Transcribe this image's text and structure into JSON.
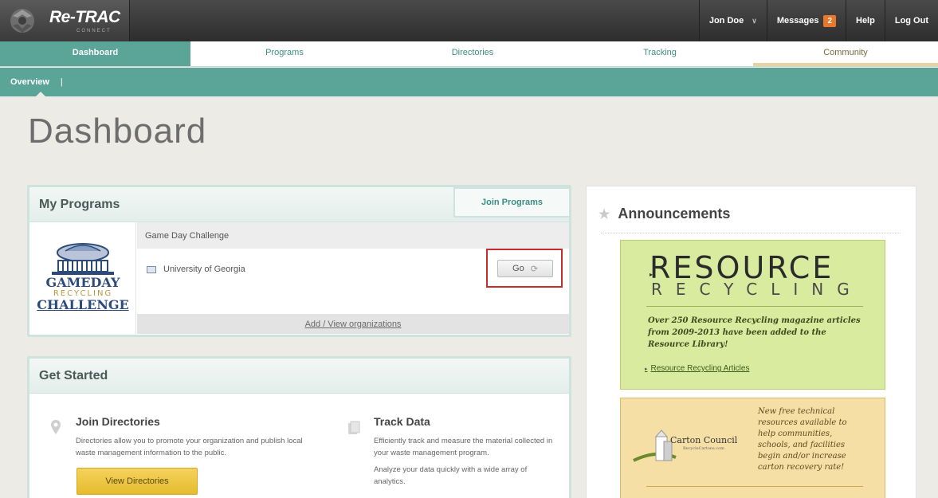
{
  "header": {
    "logo_text": "Re-TRAC",
    "logo_sub": "CONNECT",
    "user_name": "Jon Doe",
    "messages_label": "Messages",
    "messages_count": "2",
    "help_label": "Help",
    "logout_label": "Log Out"
  },
  "nav": {
    "tabs": [
      {
        "label": "Dashboard"
      },
      {
        "label": "Programs"
      },
      {
        "label": "Directories"
      },
      {
        "label": "Tracking"
      },
      {
        "label": "Community"
      }
    ]
  },
  "subnav": {
    "overview_label": "Overview",
    "separator": "|"
  },
  "page": {
    "title": "Dashboard"
  },
  "my_programs": {
    "title": "My Programs",
    "join_button": "Join Programs",
    "program_name": "Game Day Challenge",
    "logo_line1": "GAMEDAY",
    "logo_line2": "RECYCLING",
    "logo_line3": "CHALLENGE",
    "organization": "University of Georgia",
    "go_button": "Go",
    "add_link": "Add / View organizations"
  },
  "get_started": {
    "title": "Get Started",
    "join_directories": {
      "title": "Join Directories",
      "text": "Directories allow you to promote your organization and publish local waste management information to the public.",
      "button": "View Directories"
    },
    "track_data": {
      "title": "Track Data",
      "text1": "Efficiently track and measure the material collected in your waste management program.",
      "text2": "Analyze your data quickly with a wide array of analytics."
    }
  },
  "announcements": {
    "title": "Announcements",
    "resource_card": {
      "brand1": "RESOURCE",
      "brand2": "RECYCLING",
      "text": "Over 250 Resource Recycling magazine articles from 2009-2013 have been added to the Resource Library!",
      "link": "Resource Recycling Articles"
    },
    "carton_card": {
      "brand": "Carton Council",
      "url": "RecycleCartons.com",
      "text": "New free technical resources available to help communities, schools, and facilities begin and/or increase carton recovery rate!"
    }
  },
  "colors": {
    "teal": "#5aa597",
    "dark_bar": "#2d2d2d",
    "badge": "#e9782b",
    "highlight_red": "#c82b2b",
    "gold_button": "#e6bb2d",
    "rr_green": "#d9eb9e",
    "cc_tan": "#f6dfa5"
  }
}
